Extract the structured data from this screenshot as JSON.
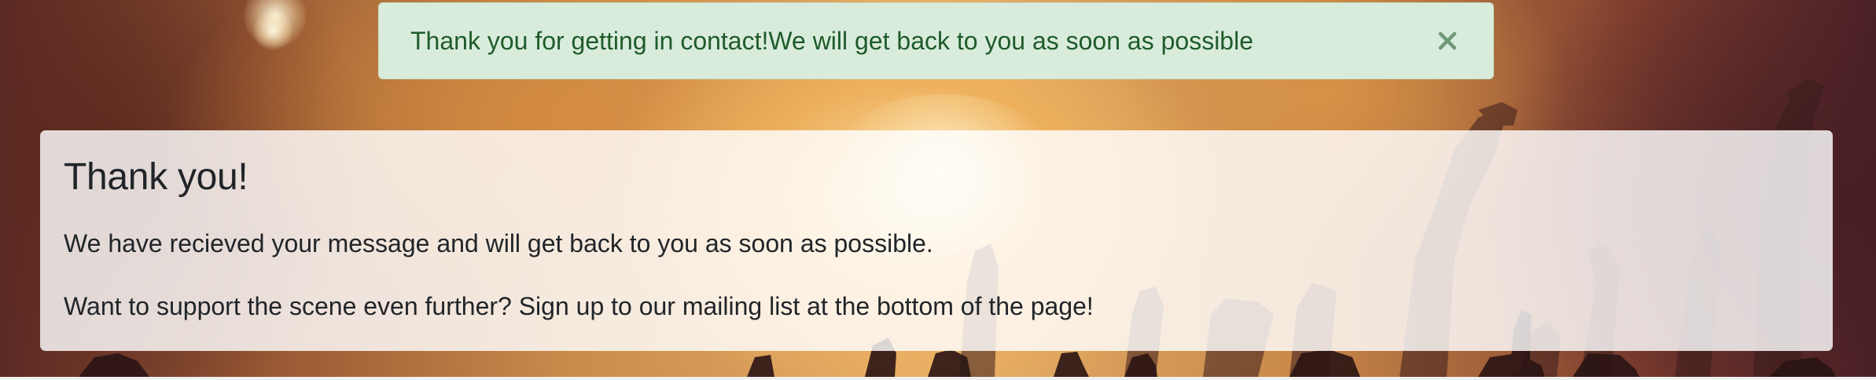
{
  "alert": {
    "message": "Thank you for getting in contact!We will get back to you as soon as possible",
    "close_icon": "close-icon",
    "color_bg": "#d9ecdc",
    "color_text": "#1f5b2b"
  },
  "card": {
    "title": "Thank you!",
    "paragraph_1": "We have recieved your message and will get back to you as soon as possible.",
    "paragraph_2": "Want to support the scene even further? Sign up to our mailing list at the bottom of the page!"
  }
}
